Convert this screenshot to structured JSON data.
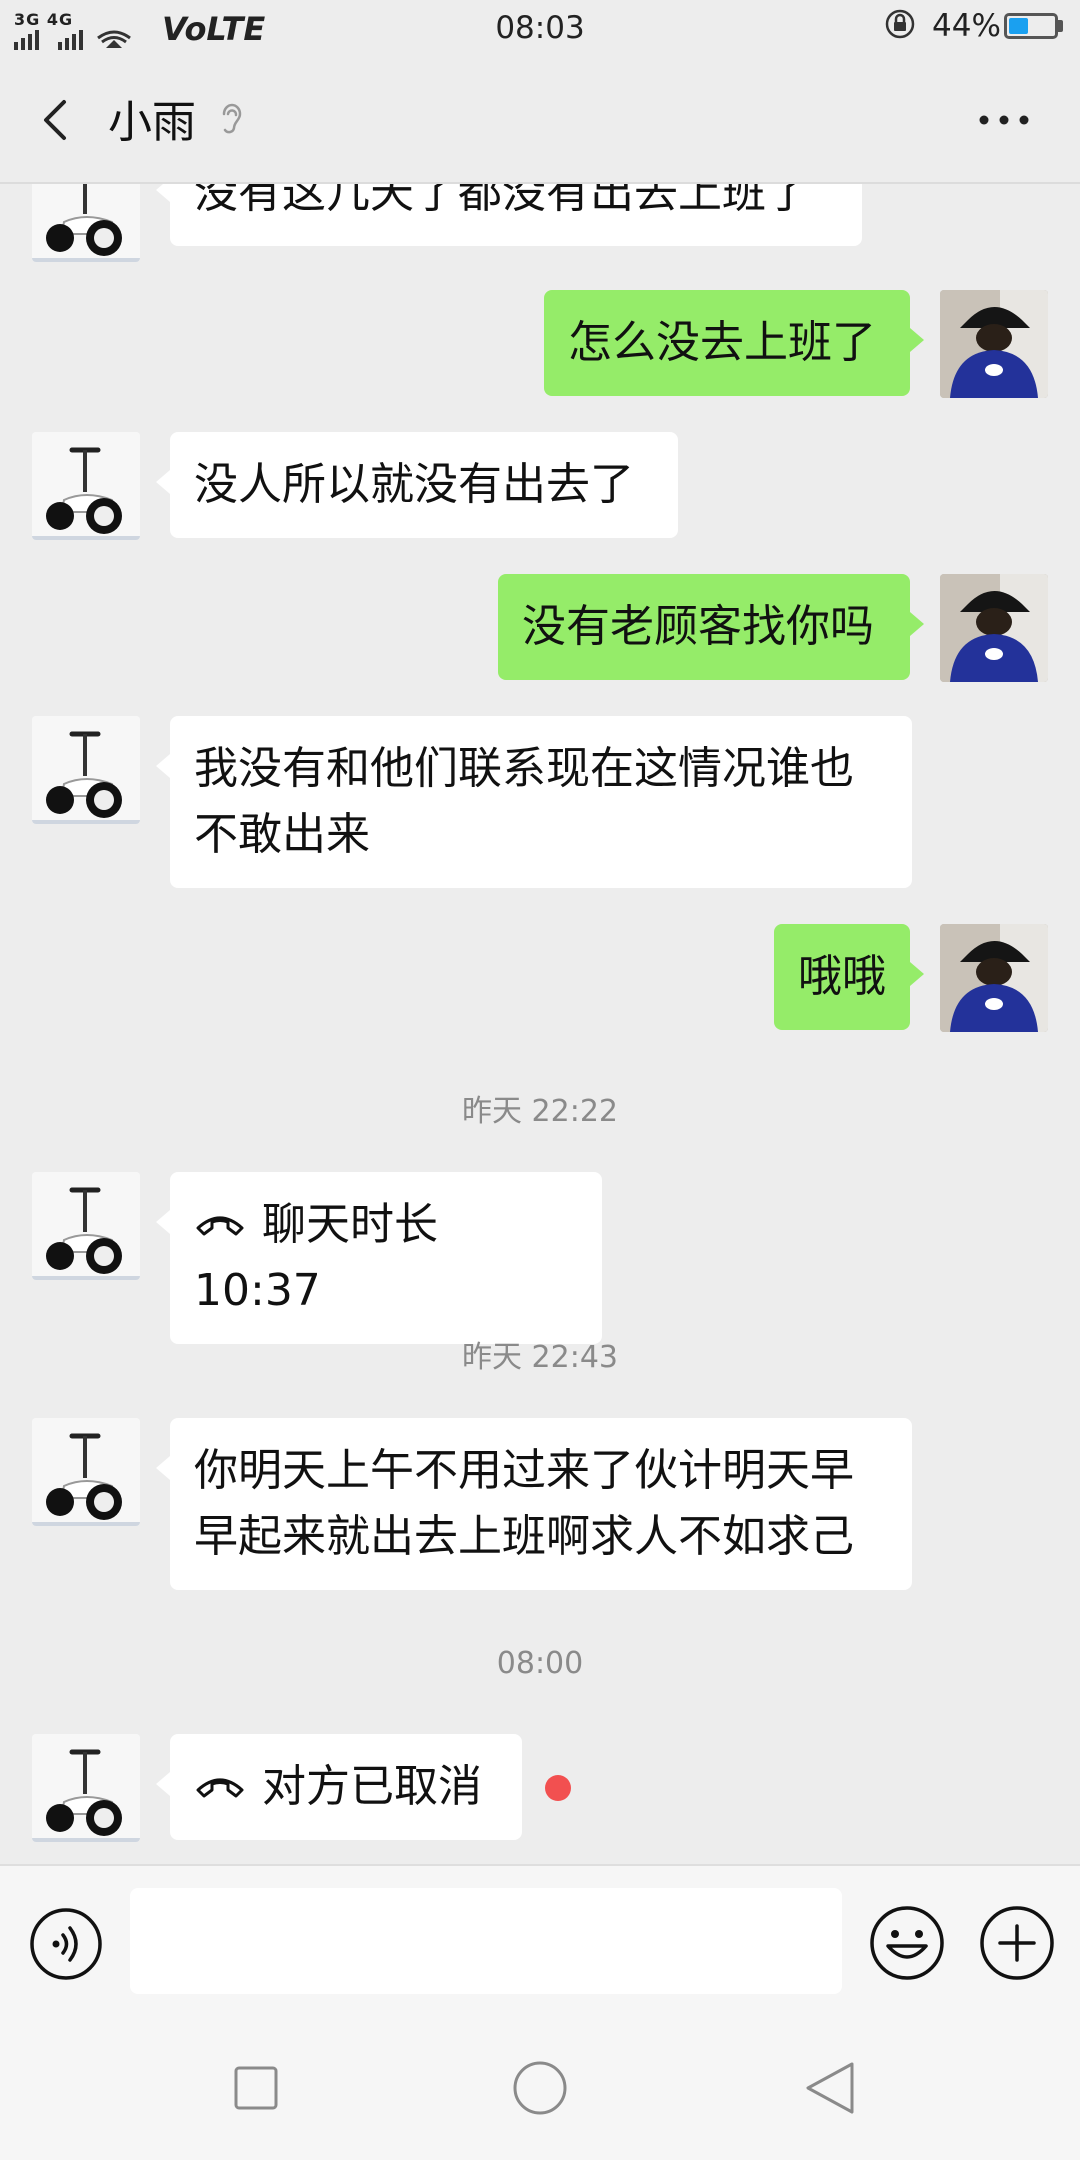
{
  "status_bar": {
    "signal_labels": "3G 4G",
    "volte": "VoLTE",
    "time": "08:03",
    "battery_percent": "44%",
    "battery_level": 0.44
  },
  "header": {
    "contact_name": "小雨",
    "icons": [
      "back-arrow-icon",
      "ear-icon",
      "more-icon"
    ]
  },
  "messages": [
    {
      "side": "in",
      "text": "没有这几天了都没有出去上班了"
    },
    {
      "side": "out",
      "text": "怎么没去上班了"
    },
    {
      "side": "in",
      "text": "没人所以就没有出去了"
    },
    {
      "side": "out",
      "text": "没有老顾客找你吗"
    },
    {
      "side": "in",
      "text": "我没有和他们联系现在这情况谁也不敢出来"
    },
    {
      "side": "out",
      "text": "哦哦"
    },
    {
      "timestamp": "昨天 22:22"
    },
    {
      "side": "in",
      "type": "call",
      "text": "聊天时长 10:37"
    },
    {
      "timestamp": "昨天 22:43"
    },
    {
      "side": "in",
      "text": "你明天上午不用过来了伙计明天早早起来就出去上班啊求人不如求己"
    },
    {
      "timestamp": "08:00"
    },
    {
      "side": "in",
      "type": "call",
      "text": "对方已取消",
      "unread": true
    }
  ],
  "input_bar": {
    "value": "",
    "placeholder": "",
    "icons": [
      "voice-icon",
      "emoji-icon",
      "plus-icon"
    ]
  },
  "nav_bar": {
    "icons": [
      "recent-apps-icon",
      "home-icon",
      "back-triangle-icon"
    ]
  },
  "colors": {
    "background": "#ededed",
    "outgoing_bubble": "#95ec69",
    "incoming_bubble": "#ffffff",
    "unread_dot": "#f25050",
    "battery": "#1aa0f0"
  }
}
